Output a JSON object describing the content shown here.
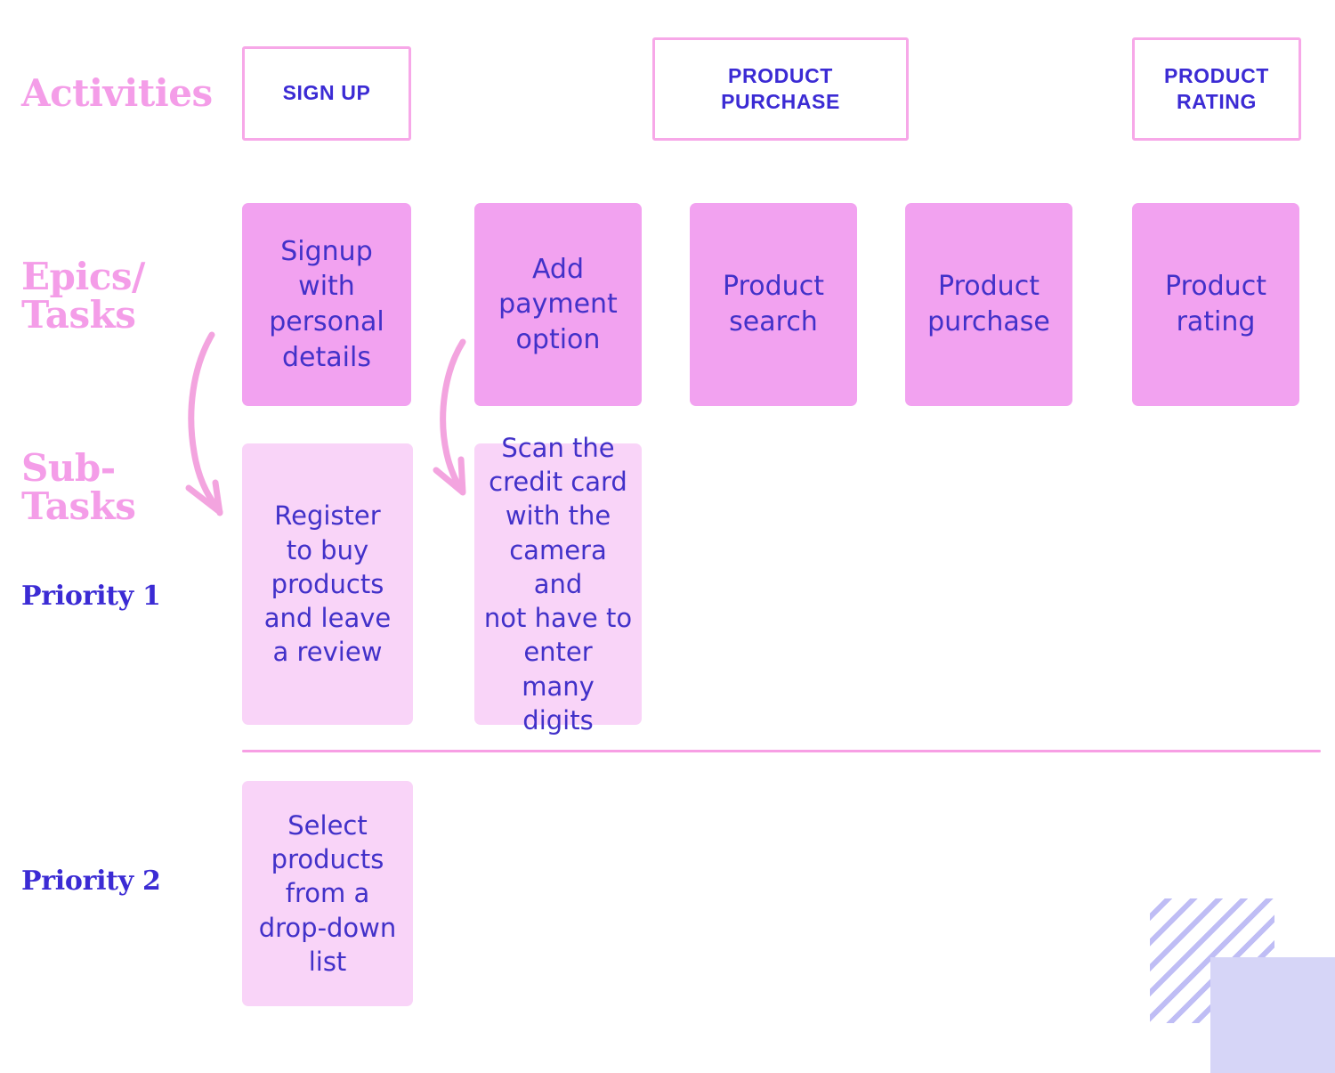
{
  "board": {
    "rows": {
      "activities_label": "Activities",
      "epics_label": "Epics/\nTasks",
      "subtasks_label": "Sub-\nTasks",
      "priority_1_label": "Priority 1",
      "priority_2_label": "Priority 2"
    },
    "activities": [
      {
        "id": "sign-up",
        "label": "SIGN UP"
      },
      {
        "id": "product-purchase",
        "label": "PRODUCT\nPURCHASE"
      },
      {
        "id": "product-rating",
        "label": "PRODUCT\nRATING"
      }
    ],
    "epics": [
      {
        "id": "signup-personal-details",
        "label": "Signup\nwith\npersonal\ndetails"
      },
      {
        "id": "add-payment-option",
        "label": "Add\npayment\noption"
      },
      {
        "id": "product-search",
        "label": "Product\nsearch"
      },
      {
        "id": "product-purchase",
        "label": "Product\npurchase"
      },
      {
        "id": "product-rating",
        "label": "Product\nrating"
      }
    ],
    "subtasks_priority_1": [
      {
        "id": "register-to-buy",
        "label": "Register\nto buy\nproducts\nand leave\na review"
      },
      {
        "id": "scan-credit-card",
        "label": "Scan the\ncredit card\nwith the\ncamera and\nnot have to\nenter many\ndigits"
      }
    ],
    "subtasks_priority_2": [
      {
        "id": "select-from-dropdown",
        "label": "Select\nproducts\nfrom a\ndrop-down\nlist"
      }
    ],
    "arrows": [
      {
        "id": "signup-to-subtask",
        "from": "signup-personal-details",
        "to": "register-to-buy"
      },
      {
        "id": "payment-to-subtask",
        "from": "add-payment-option",
        "to": "scan-credit-card"
      }
    ],
    "colors": {
      "row_label_pink": "#F49DE8",
      "epic_note_pink": "#F2A2F0",
      "subtask_note_pink": "#F9D4F8",
      "ink_purple": "#4231C9",
      "header_purple": "#3B2BD4",
      "outline_pink": "#F7A8E8",
      "divider_pink": "#F79FE4",
      "arrow_pink": "#F3A4DF",
      "decor_stripe_lavender": "#BFBDF5",
      "decor_square_lavender": "#D6D5F7",
      "background": "#FFFFFF"
    }
  }
}
